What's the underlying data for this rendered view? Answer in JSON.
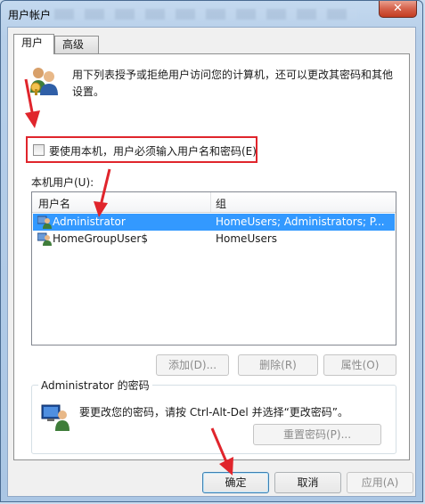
{
  "window": {
    "title": "用户帐户",
    "close_glyph": "✕"
  },
  "tabs": [
    {
      "label": "用户"
    },
    {
      "label": "高级"
    }
  ],
  "intro_text": "用下列表授予或拒绝用户访问您的计算机，还可以更改其密码和其他设置。",
  "require_login": {
    "label": "要使用本机，用户必须输入用户名和密码(E)",
    "checked": false
  },
  "local_users": {
    "label": "本机用户(U):",
    "columns": [
      "用户名",
      "组"
    ],
    "rows": [
      {
        "name": "Administrator",
        "group": "HomeUsers; Administrators; P...",
        "selected": true
      },
      {
        "name": "HomeGroupUser$",
        "group": "HomeUsers",
        "selected": false
      }
    ]
  },
  "list_buttons": {
    "add": "添加(D)...",
    "remove": "删除(R)",
    "properties": "属性(O)"
  },
  "password_group": {
    "title": "Administrator 的密码",
    "text": "要更改您的密码，请按 Ctrl-Alt-Del 并选择“更改密码”。",
    "reset_button": "重置密码(P)..."
  },
  "dialog_buttons": {
    "ok": "确定",
    "cancel": "取消",
    "apply": "应用(A)"
  },
  "icons": {
    "title_icon": "none",
    "users": "users-group-icon",
    "row_user": "user-icon",
    "password": "computer-user-icon",
    "annotation": "red-arrow-icon"
  },
  "colors": {
    "selection": "#3399ff",
    "annotation_red": "#e0252c"
  }
}
